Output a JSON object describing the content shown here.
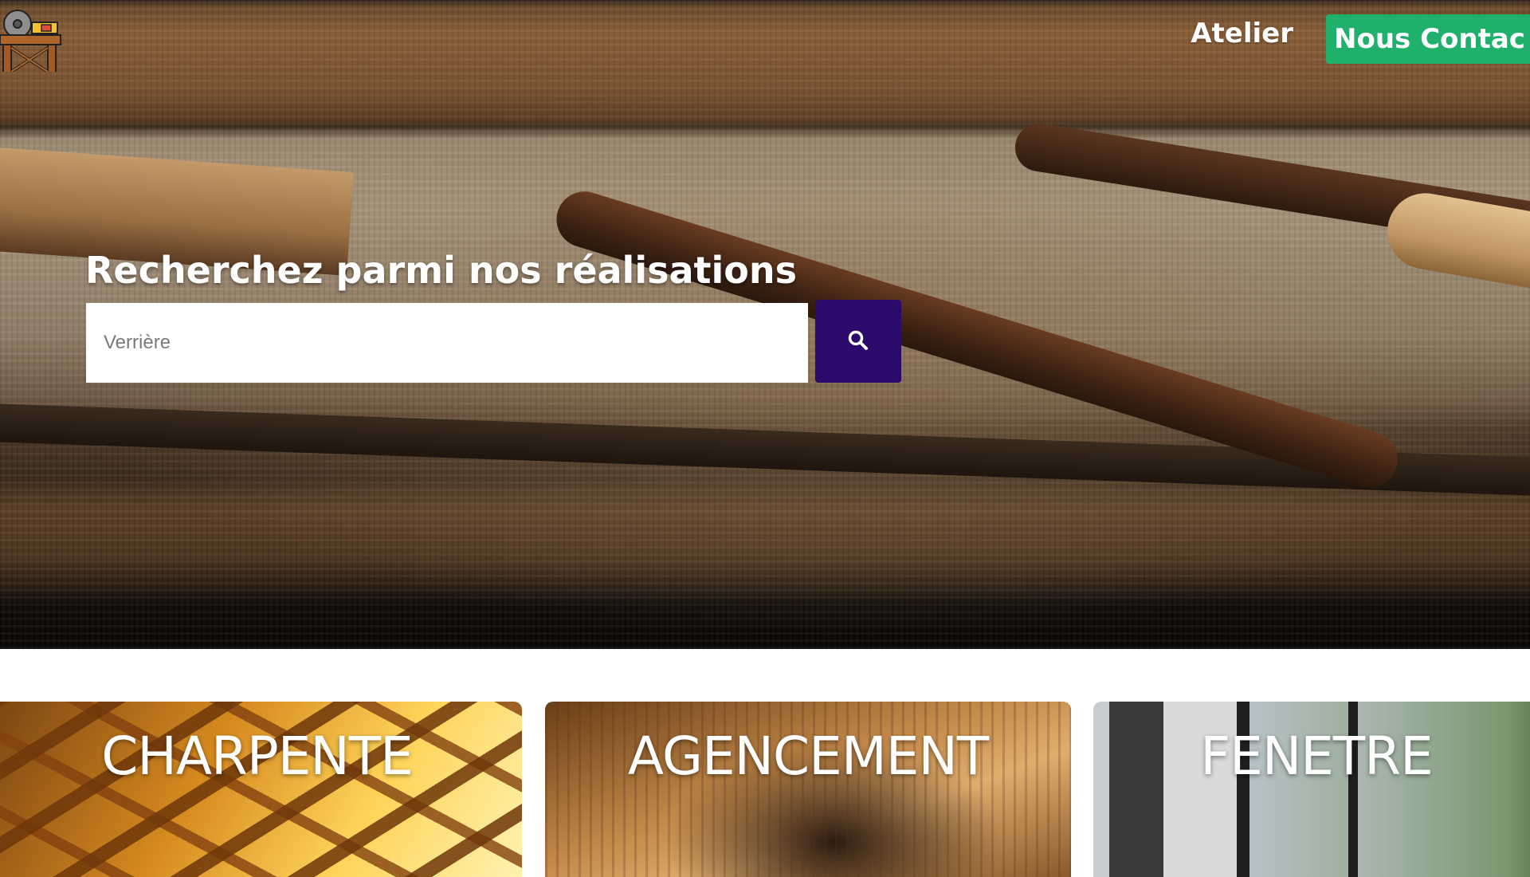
{
  "header": {
    "logo_icon": "sawmill-workbench-icon",
    "nav": {
      "atelier_label": "Atelier",
      "contact_label": "Nous Contac"
    }
  },
  "hero": {
    "search_title": "Recherchez parmi nos réalisations",
    "search_placeholder": "Verrière",
    "search_icon": "search-icon"
  },
  "categories": [
    {
      "label": "CHARPENTE"
    },
    {
      "label": "AGENCEMENT"
    },
    {
      "label": "FENETRE"
    }
  ],
  "colors": {
    "contact_button": "#1fb06b",
    "search_button": "#2a0a6a"
  }
}
